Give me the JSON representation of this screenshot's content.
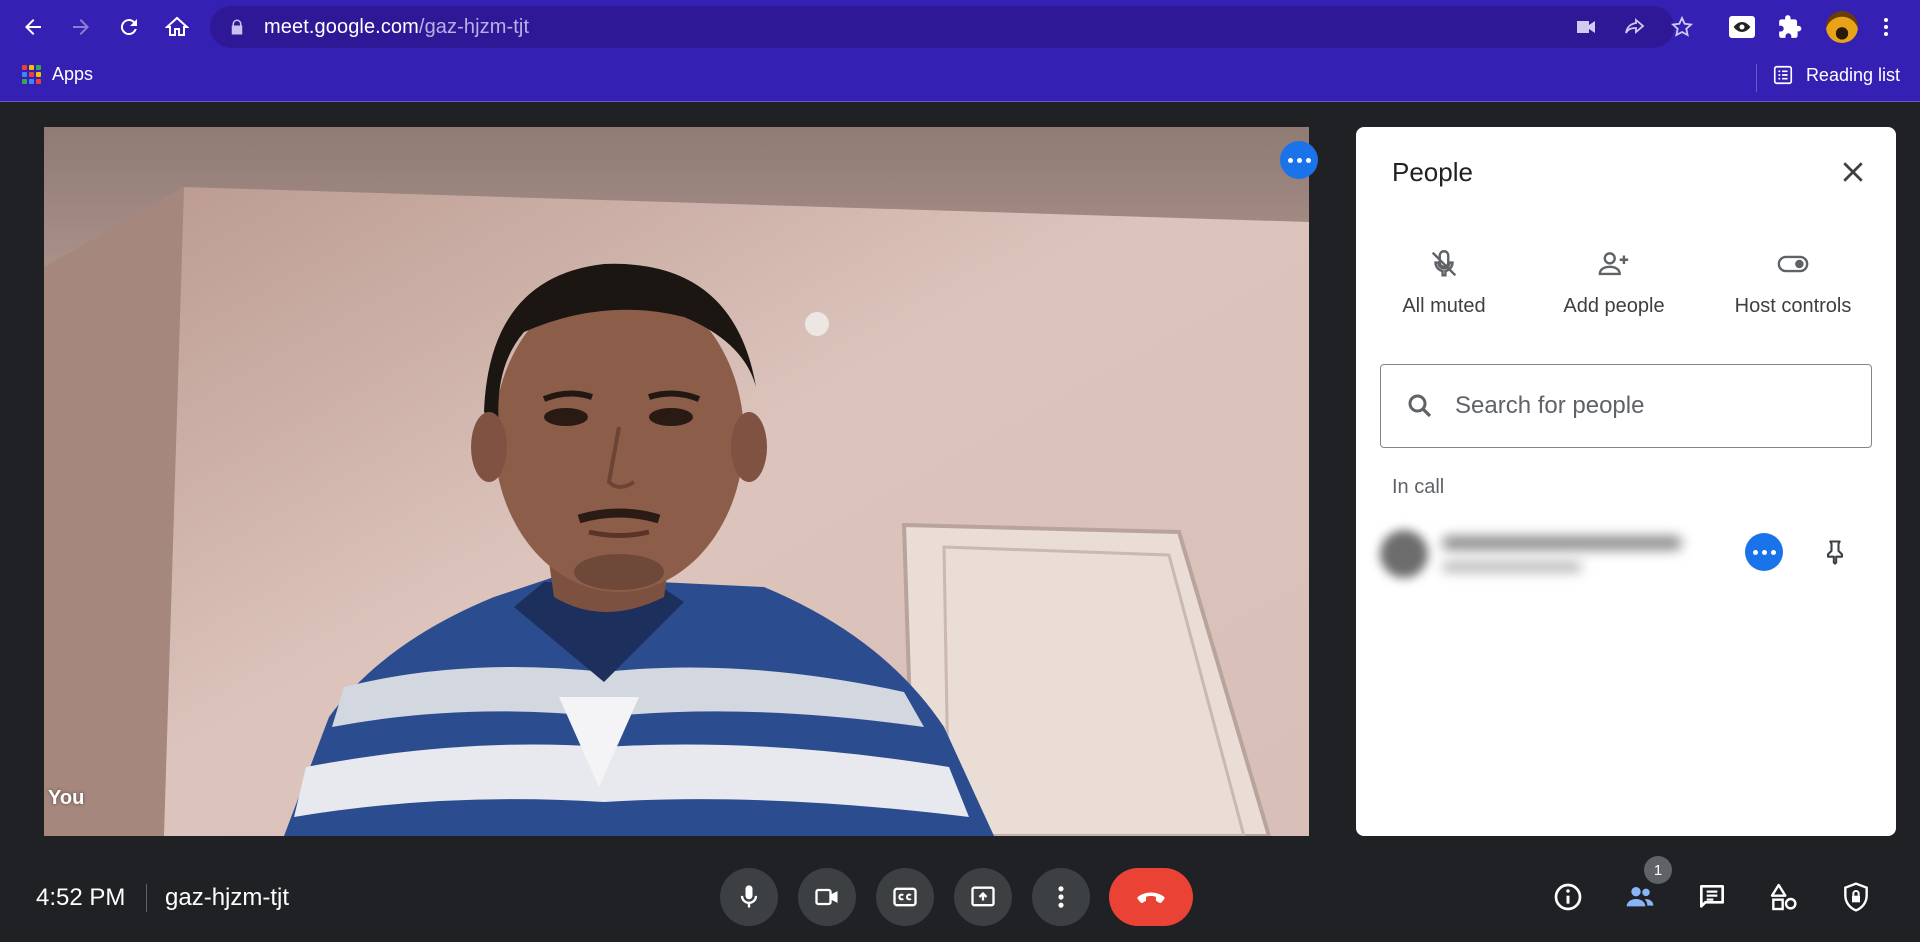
{
  "browser": {
    "url_host": "meet.google.com",
    "url_path": "/gaz-hjzm-tjt",
    "bookmarks": {
      "apps_label": "Apps",
      "reading_list_label": "Reading list"
    },
    "apps_colors": [
      "#ea4335",
      "#fbbc04",
      "#34a853",
      "#4285f4",
      "#ea4335",
      "#fbbc04",
      "#34a853",
      "#4285f4",
      "#ea4335"
    ]
  },
  "video": {
    "self_label": "You"
  },
  "people_panel": {
    "title": "People",
    "actions": [
      {
        "label": "All muted",
        "icon": "mic-off-icon"
      },
      {
        "label": "Add people",
        "icon": "person-add-icon"
      },
      {
        "label": "Host controls",
        "icon": "toggle-icon"
      }
    ],
    "search_placeholder": "Search for people",
    "section_label": "In call"
  },
  "bottom_bar": {
    "time": "4:52 PM",
    "meeting_code": "gaz-hjzm-tjt",
    "people_count": "1"
  },
  "colors": {
    "chrome": "#3520b4",
    "accent": "#1a73e8",
    "hangup": "#ea4335",
    "dark": "#202124"
  }
}
